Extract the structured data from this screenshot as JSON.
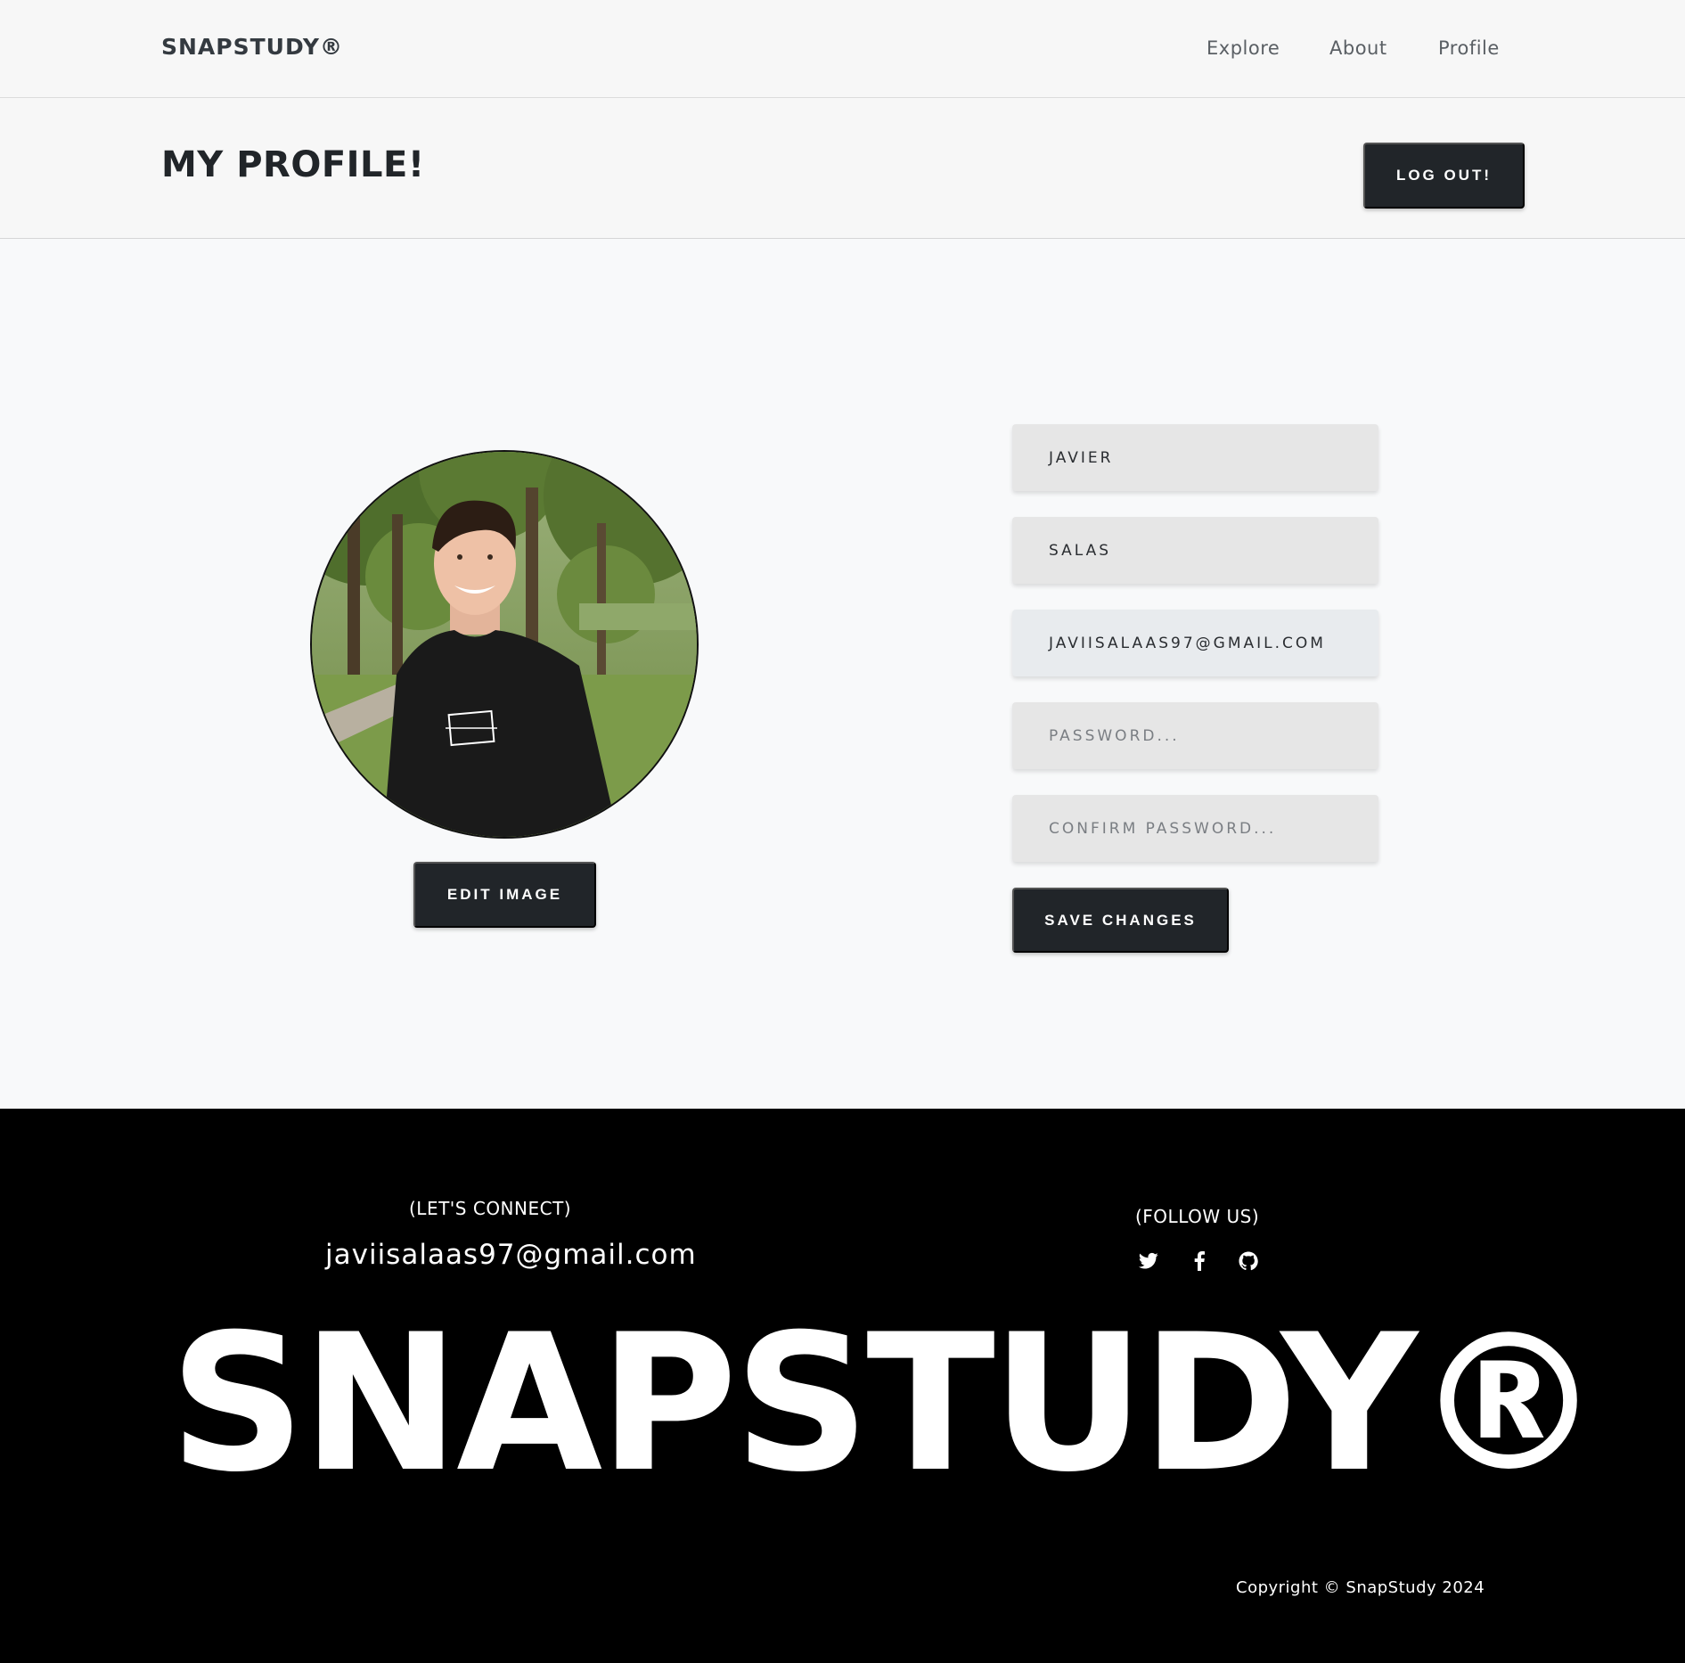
{
  "navbar": {
    "brand": "SNAPSTUDY®",
    "links": [
      "Explore",
      "About",
      "Profile"
    ]
  },
  "header": {
    "title": "MY PROFILE!",
    "logout_label": "LOG OUT!"
  },
  "profile": {
    "avatar_alt": "Profile photo",
    "edit_image_label": "EDIT IMAGE",
    "fields": {
      "first_name": "JAVIER",
      "last_name": "SALAS",
      "email": "JAVIISALAAS97@GMAIL.COM",
      "password_placeholder": "PASSWORD...",
      "confirm_password_placeholder": "CONFIRM PASSWORD..."
    },
    "save_label": "SAVE CHANGES"
  },
  "footer": {
    "connect_label": "(LET'S CONNECT)",
    "connect_email": "javiisalaas97@gmail.com",
    "follow_label": "(FOLLOW US)",
    "social_icons": [
      "twitter-icon",
      "facebook-icon",
      "github-icon"
    ],
    "big_brand": "SNAPSTUDY®",
    "copyright": "Copyright © SnapStudy 2024"
  }
}
